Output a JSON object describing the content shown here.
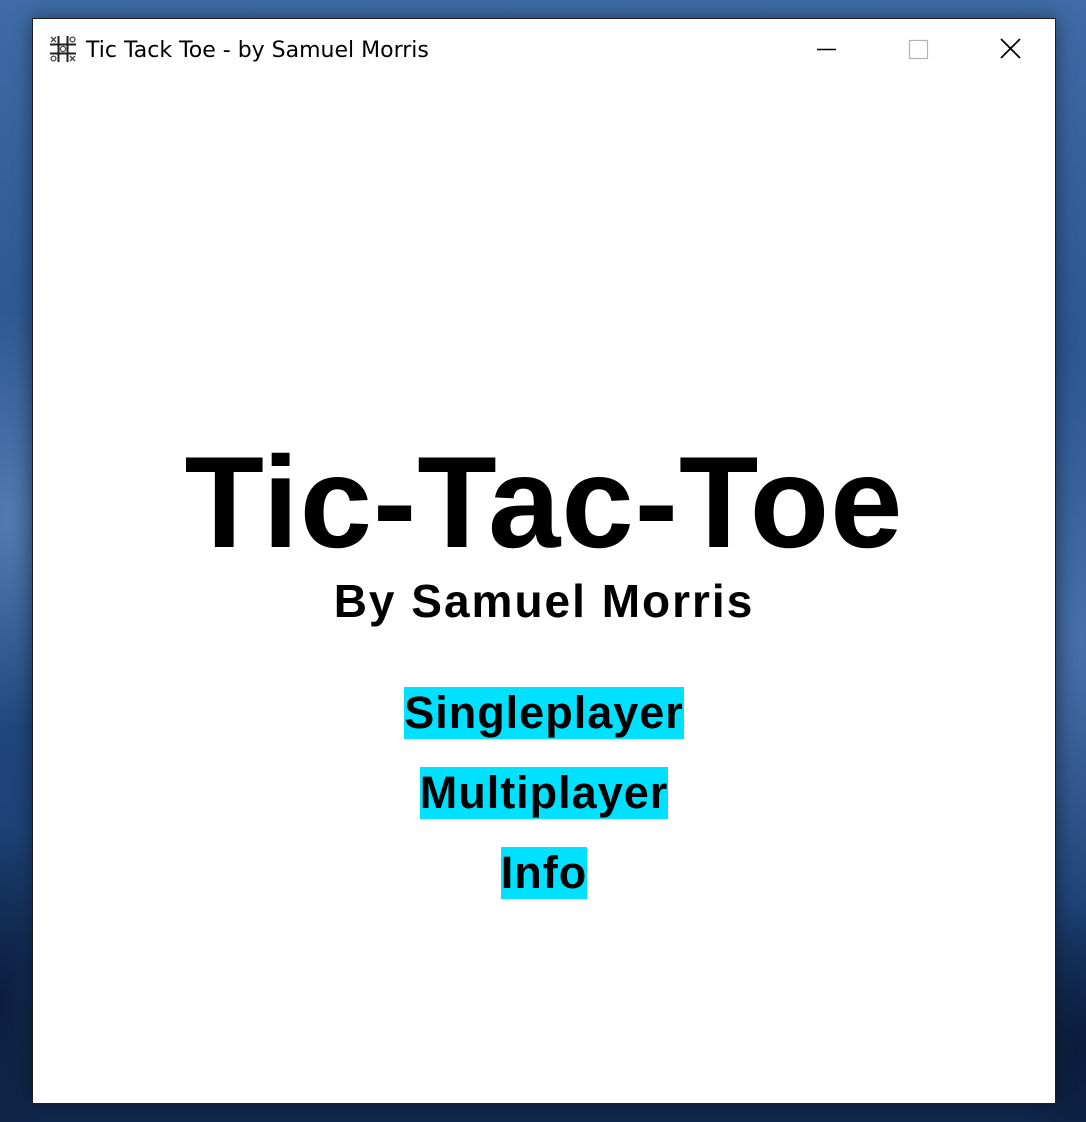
{
  "window": {
    "title": "Tic Tack Toe - by Samuel Morris",
    "icon": "tic-tac-toe-grid-icon",
    "controls": {
      "minimize": "minimize-icon",
      "maximize": "maximize-icon",
      "close": "close-icon"
    }
  },
  "screen": {
    "title": "Tic-Tac-Toe",
    "byline": "By Samuel Morris"
  },
  "menu": {
    "items": [
      {
        "label": "Singleplayer"
      },
      {
        "label": "Multiplayer"
      },
      {
        "label": "Info"
      }
    ]
  },
  "colors": {
    "menu_button_bg": "#00e1ff",
    "text": "#000000",
    "window_bg": "#ffffff"
  }
}
